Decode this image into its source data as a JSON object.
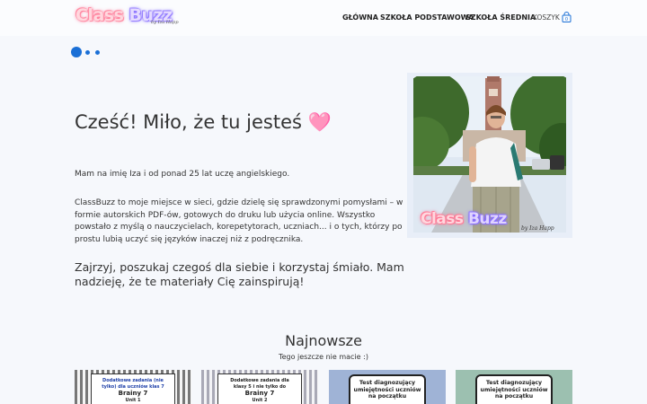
{
  "header": {
    "logo": {
      "text_a": "Class",
      "text_b": "Buzz",
      "signature": "by Iza Happ"
    },
    "nav": [
      {
        "label": "GŁÓWNA"
      },
      {
        "label": "SZKOŁA PODSTAWOWA"
      },
      {
        "label": "SZKOŁA ŚREDNIA"
      }
    ],
    "cart": {
      "label": "KOSZYK",
      "count": "0"
    }
  },
  "slider": {
    "dots": 3,
    "active": 0
  },
  "hero": {
    "title": "Cześć! Miło, że tu jesteś 🩷",
    "p1": "Mam na imię Iza i od ponad 25 lat uczę angielskiego.",
    "p2": "ClassBuzz to moje miejsce w sieci, gdzie dzielę się sprawdzonymi pomysłami – w formie autorskich PDF-ów, gotowych do druku lub użycia online. Wszystko powstało z myślą o nauczycielach, korepetytorach, uczniach... i o tych, którzy po prostu lubią uczyć się języków inaczej niż z podręcznika.",
    "p3": "Zajrzyj, poszukaj czegoś dla siebie i korzystaj śmiało. Mam nadzieję, że te materiały Cię zainspirują!",
    "photo_logo": {
      "text_a": "Class",
      "text_b": "Buzz",
      "signature": "by Iza Happ"
    }
  },
  "newest": {
    "title": "Najnowsze",
    "subtitle": "Tego jeszcze nie macie :)",
    "products": [
      {
        "line1": "Dodatkowe zadania (nie",
        "line2": "tylko) dla uczniów klas 7",
        "line3": "Brainy 7",
        "line4": "Unit 1",
        "bg": "#8c8c8c"
      },
      {
        "line1": "Dodatkowe zadania dla",
        "line2": "klasy 5 i nie tylko do",
        "line3": "Brainy 7",
        "line4": "Unit 2",
        "bg": "#b9b9c4"
      },
      {
        "line1": "Test diagnozujący",
        "line2": "umiejętności uczniów",
        "line3": "na początku",
        "bg": "#9fb3d6"
      },
      {
        "line1": "Test diagnozujący",
        "line2": "umiejętności uczniów",
        "line3": "na początku",
        "bg": "#9cc0b0"
      }
    ]
  },
  "colors": {
    "accent": "#1a6fd6",
    "cart": "#1a6fd6",
    "background": "#f6f8fc"
  }
}
